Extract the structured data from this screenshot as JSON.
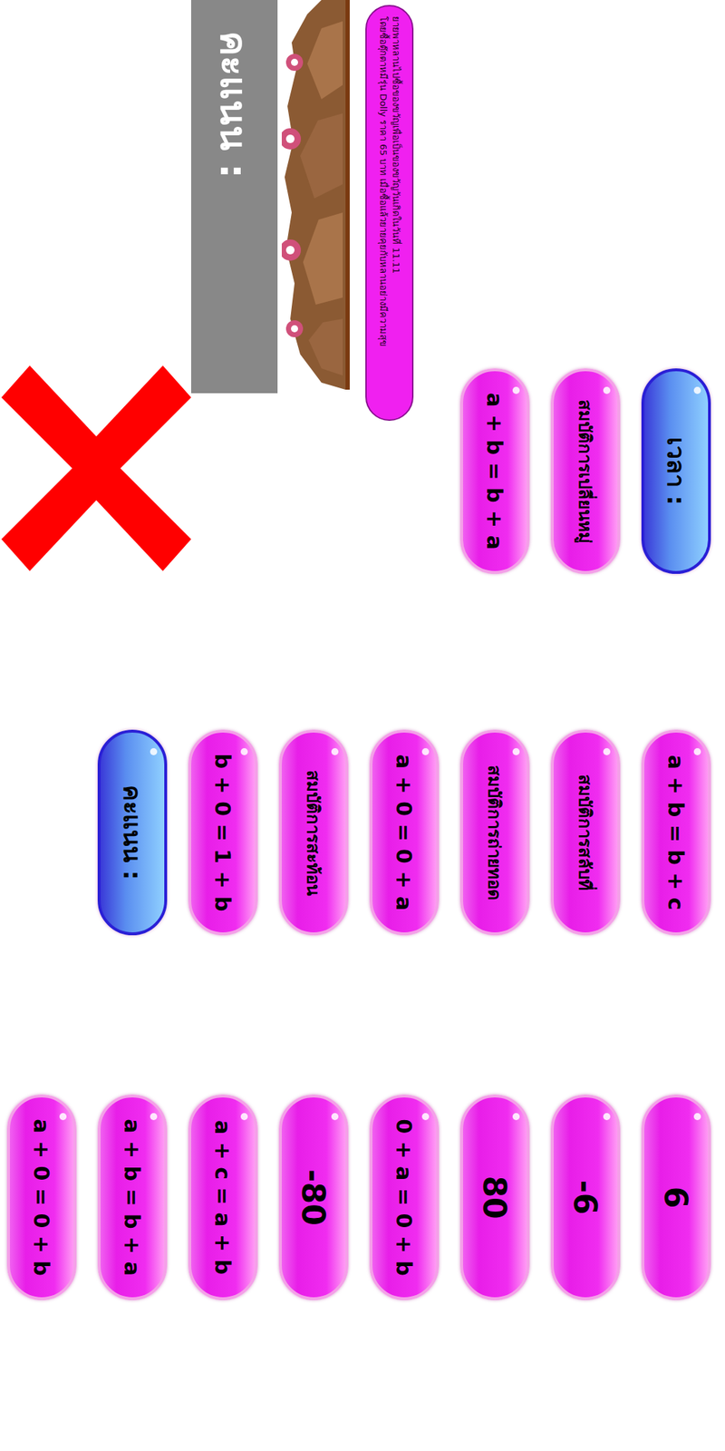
{
  "timer": {
    "label": "เวลา :"
  },
  "score_box": {
    "label": "คะแนน :"
  },
  "story": {
    "lines": [
      "ยายพาหลานไปซื้อของขวัญเพื่อเป็นของขวัญวันเกิดในวันที่ 11.11",
      "โดยซื้อตุ๊กตาหมีรุ่น Dolly ราคา 65 บาท เมื่อซื้อแล้วยายคุยกับหลานอย่างมีความสุข"
    ]
  },
  "columns": [
    {
      "cards": [
        {
          "text": "เวลา :",
          "kind": "label"
        },
        {
          "text": "สมบัติการเปลี่ยนหมู่",
          "kind": "property"
        },
        {
          "text": "a + b = b + a",
          "kind": "equation"
        }
      ]
    },
    {
      "cards": [
        {
          "text": "a + b = b + c",
          "kind": "equation"
        },
        {
          "text": "สมบัติการสลับที่",
          "kind": "property"
        },
        {
          "text": "สมบัติการถ่ายทอด",
          "kind": "property"
        },
        {
          "text": "a + 0 = 0 + a",
          "kind": "equation"
        },
        {
          "text": "สมบัติการสะท้อน",
          "kind": "property"
        },
        {
          "text": "b + 0 = 1 + b",
          "kind": "equation"
        },
        {
          "text": "คะแนน :",
          "kind": "label"
        }
      ]
    },
    {
      "cards": [
        {
          "text": "6",
          "kind": "number"
        },
        {
          "text": "-6",
          "kind": "number"
        },
        {
          "text": "80",
          "kind": "number"
        },
        {
          "text": "0 + a = 0 + b",
          "kind": "equation"
        },
        {
          "text": "-80",
          "kind": "number"
        },
        {
          "text": "a + c = a + b",
          "kind": "equation"
        },
        {
          "text": "a + b = b + a",
          "kind": "equation"
        },
        {
          "text": "a + 0 = 0 + b",
          "kind": "equation"
        }
      ]
    }
  ]
}
